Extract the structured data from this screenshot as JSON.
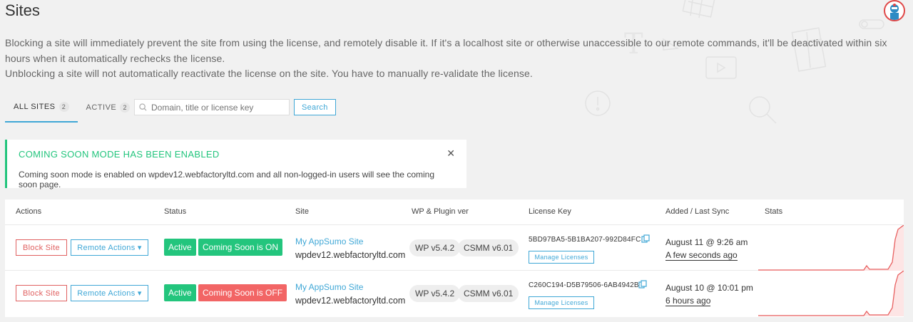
{
  "page": {
    "title": "Sites",
    "description_1": "Blocking a site will immediately prevent the site from using the license, and remotely disable it. If it's a localhost site or otherwise unaccessible to our remote commands, it'll be deactivated within six hours when it automatically rechecks the license.",
    "description_2": "Unblocking a site will not automatically reactivate the license on the site. You have to manually re-validate the license."
  },
  "tabs": [
    {
      "label": "ALL SITES",
      "count": "2",
      "active": true
    },
    {
      "label": "ACTIVE",
      "count": "2",
      "active": false
    }
  ],
  "search": {
    "placeholder": "Domain, title or license key",
    "value": "",
    "button_label": "Search"
  },
  "notice": {
    "title": "COMING SOON MODE HAS BEEN ENABLED",
    "text": "Coming soon mode is enabled on wpdev12.webfactoryltd.com and all non-logged-in users will see the coming soon page.",
    "close_glyph": "✕"
  },
  "table": {
    "headers": [
      "Actions",
      "Status",
      "Site",
      "WP & Plugin ver",
      "License Key",
      "Added / Last Sync",
      "Stats"
    ],
    "rows": [
      {
        "block_label": "Block Site",
        "remote_label": "Remote Actions",
        "remote_caret": "▾",
        "status": "Active",
        "coming_soon": "Coming Soon is ON",
        "site_name": "My AppSumo Site",
        "site_url": "wpdev12.webfactoryltd.com",
        "wp_version": "WP v5.4.2",
        "plugin_version": "CSMM v6.01",
        "license_key": "5BD97BA5-5B1BA207-992D84FC",
        "manage_label": "Manage Licenses",
        "added": "August 11 @ 9:26 am",
        "last_sync": "A few seconds ago"
      },
      {
        "block_label": "Block Site",
        "remote_label": "Remote Actions",
        "remote_caret": "▾",
        "status": "Active",
        "coming_soon": "Coming Soon is OFF",
        "site_name": "My AppSumo Site",
        "site_url": "wpdev12.webfactoryltd.com",
        "wp_version": "WP v5.4.2",
        "plugin_version": "CSMM v6.01",
        "license_key": "C260C194-D5B79506-6AB4942B",
        "manage_label": "Manage Licenses",
        "added": "August 10 @ 10:01 pm",
        "last_sync": "6 hours ago"
      }
    ]
  },
  "colors": {
    "accent": "#3fa7d6",
    "success": "#23c57d",
    "danger": "#f26565",
    "sparkline": "#e86060"
  },
  "icons": {
    "search": "search-icon",
    "copy": "copy-icon",
    "close": "close-icon",
    "avatar": "avatar-icon"
  }
}
